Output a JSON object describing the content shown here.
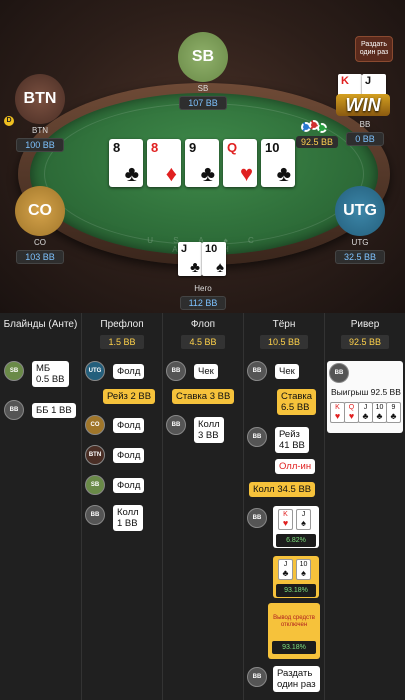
{
  "table": {
    "felt_text": "U S A  ♠  C A S H",
    "deal_once_tooltip": "Раздать один раз",
    "win_badge": "WIN",
    "pot": "92.5 BB",
    "dealer_button": "D"
  },
  "players": {
    "sb": {
      "avatar": "SB",
      "name": "SB",
      "stack": "107 BB"
    },
    "btn": {
      "avatar": "BTN",
      "name": "BTN",
      "stack": "100 BB"
    },
    "bb": {
      "name": "BB",
      "stack": "0 BB",
      "cards": [
        {
          "rank": "K",
          "suit": "♥"
        },
        {
          "rank": "J",
          "suit": "♠"
        }
      ]
    },
    "co": {
      "avatar": "CO",
      "name": "CO",
      "stack": "103 BB"
    },
    "utg": {
      "avatar": "UTG",
      "name": "UTG",
      "stack": "32.5 BB"
    },
    "hero": {
      "name": "Него",
      "stack": "112 BB",
      "cards": [
        {
          "rank": "J",
          "suit": "♣"
        },
        {
          "rank": "10",
          "suit": "♠"
        }
      ]
    }
  },
  "board": [
    {
      "rank": "8",
      "suit": "♣",
      "color": "black"
    },
    {
      "rank": "8",
      "suit": "♦",
      "color": "red"
    },
    {
      "rank": "9",
      "suit": "♣",
      "color": "black"
    },
    {
      "rank": "Q",
      "suit": "♥",
      "color": "red"
    },
    {
      "rank": "10",
      "suit": "♣",
      "color": "black"
    }
  ],
  "history": {
    "columns": [
      {
        "title": "Блайнды (Анте)",
        "value": ""
      },
      {
        "title": "Префлоп",
        "value": "1.5 BB"
      },
      {
        "title": "Флоп",
        "value": "4.5 BB"
      },
      {
        "title": "Тёрн",
        "value": "10.5 BB"
      },
      {
        "title": "Ривер",
        "value": "92.5 BB"
      }
    ],
    "blinds": [
      {
        "pos": "SB",
        "label": "МБ\n0.5 BB"
      },
      {
        "pos": "BB",
        "label": "ББ 1 BB"
      }
    ],
    "preflop": [
      {
        "pos": "UTG",
        "label": "Фолд"
      },
      {
        "pos": "",
        "label": "Рейз 2 BB"
      },
      {
        "pos": "CO",
        "label": "Фолд"
      },
      {
        "pos": "BTN",
        "label": "Фолд"
      },
      {
        "pos": "SB",
        "label": "Фолд"
      },
      {
        "pos": "BB",
        "label": "Колл\n1 BB"
      }
    ],
    "flop": [
      {
        "pos": "BB",
        "label": "Чек"
      },
      {
        "pos": "",
        "label": "Ставка 3 BB"
      },
      {
        "pos": "BB",
        "label": "Колл\n3 BB"
      }
    ],
    "turn": [
      {
        "pos": "BB",
        "label": "Чек"
      },
      {
        "pos": "",
        "label": "Ставка\n6.5 BB"
      },
      {
        "pos": "BB",
        "label": "Рейз\n41 BB"
      },
      {
        "pos": "",
        "label": "Олл-ин"
      },
      {
        "pos": "",
        "label": "Колл 34.5 BB"
      },
      {
        "pos": "BB",
        "equity": "6.82%"
      },
      {
        "pos": "",
        "equity": "93.18%"
      },
      {
        "pos": "",
        "label": "Вывод средств отключен",
        "equity": "93.18%"
      },
      {
        "pos": "BB",
        "label": "Раздать\nодин раз"
      }
    ],
    "river": {
      "pos": "BB",
      "label": "Выигрыш 92.5 BB",
      "cards": [
        {
          "rank": "K",
          "suit": "♥"
        },
        {
          "rank": "Q",
          "suit": "♥"
        },
        {
          "rank": "J",
          "suit": "♣"
        },
        {
          "rank": "10",
          "suit": "♣"
        },
        {
          "rank": "9",
          "suit": "♣"
        }
      ]
    }
  }
}
